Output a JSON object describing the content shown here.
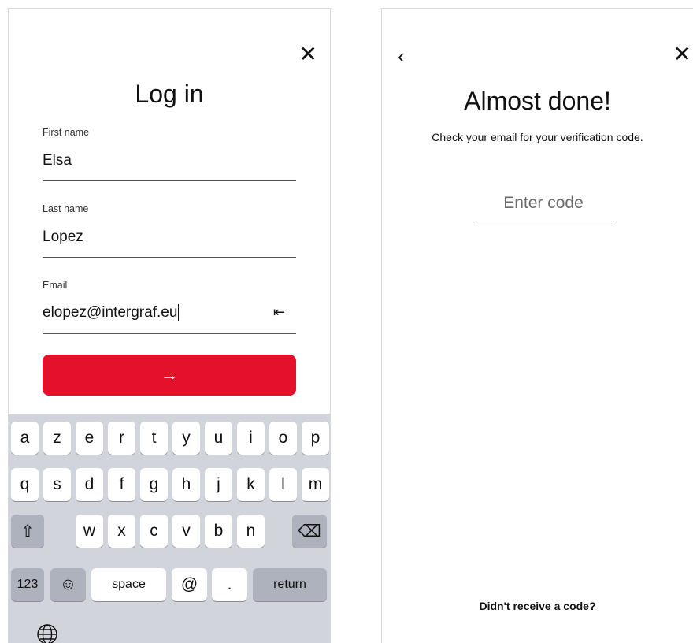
{
  "login": {
    "close_glyph": "✕",
    "title": "Log in",
    "first_name": {
      "label": "First name",
      "value": "Elsa"
    },
    "last_name": {
      "label": "Last name",
      "value": "Lopez"
    },
    "email": {
      "label": "Email",
      "value": "elopez@intergraf.eu"
    },
    "clear_glyph": "⇤",
    "submit_glyph": "→"
  },
  "keyboard": {
    "row1": [
      "a",
      "z",
      "e",
      "r",
      "t",
      "y",
      "u",
      "i",
      "o",
      "p"
    ],
    "row2": [
      "q",
      "s",
      "d",
      "f",
      "g",
      "h",
      "j",
      "k",
      "l",
      "m"
    ],
    "row3": [
      "w",
      "x",
      "c",
      "v",
      "b",
      "n"
    ],
    "shift_glyph": "⇧",
    "backspace_glyph": "⌫",
    "numbers_label": "123",
    "emoji_glyph": "☺",
    "space_label": "space",
    "at_label": "@",
    "dot_label": ".",
    "return_label": "return",
    "globe_icon": "globe-icon"
  },
  "verify": {
    "back_glyph": "‹",
    "close_glyph": "✕",
    "title": "Almost done!",
    "subtitle": "Check your email for your verification code.",
    "code_placeholder": "Enter code",
    "resend_label": "Didn't receive a code?"
  },
  "colors": {
    "accent": "#e4112b",
    "keyboard_bg": "#d2d4db",
    "key_dark": "#aeb2bd"
  }
}
